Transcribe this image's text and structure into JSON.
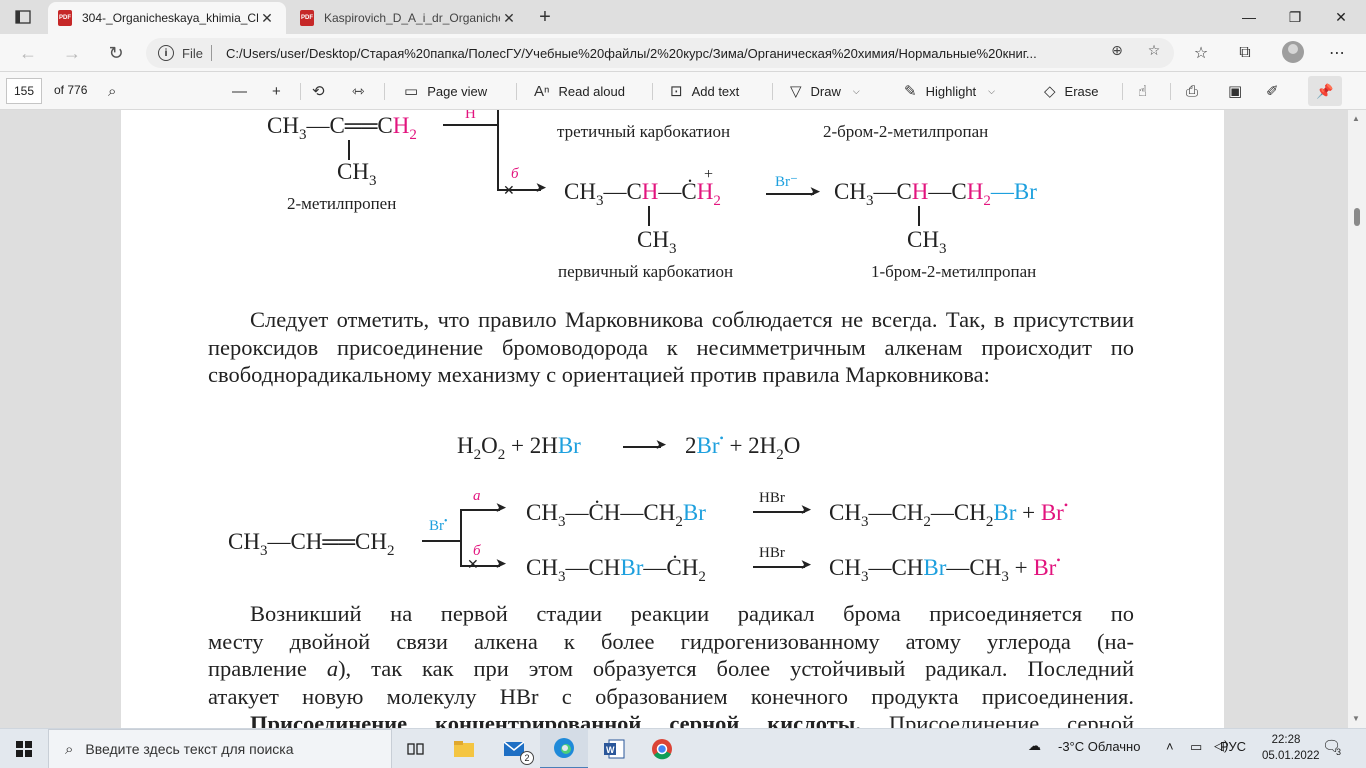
{
  "browser": {
    "tabs": [
      {
        "title": "304-_Organicheskaya_khimia_Ch",
        "active": true
      },
      {
        "title": "Kaspirovich_D_A_i_dr_Organiche",
        "active": false
      }
    ],
    "new_tab": "+",
    "file_label": "File",
    "url": "C:/Users/user/Desktop/Старая%20папка/ПолесГУ/Учебные%20файлы/2%20курс/Зима/Органическая%20химия/Нормальные%20книг..."
  },
  "pdf_toolbar": {
    "page_number": "155",
    "page_total": "of 776",
    "page_view": "Page view",
    "read_aloud": "Read aloud",
    "add_text": "Add text",
    "draw": "Draw",
    "highlight": "Highlight",
    "erase": "Erase"
  },
  "document": {
    "top_scheme": {
      "reactant_main": "CH",
      "reactant_methyl": "CH",
      "reactant_name": "2-метилпропен",
      "branch_label_b": "б",
      "branch_label_a_fragment": "H",
      "tert_cation_name": "третичный карбокатион",
      "tert_product_name": "2-бром-2-метилпропан",
      "primary_cation_name": "первичный карбокатион",
      "primary_product_name": "1-бром-2-метилпропан",
      "reagent": "Br"
    },
    "paragraph1": "Следует отметить, что правило Марковникова соблюдается не всегда. Так, в присутствии пероксидов присоединение бромоводорода к несимметричным алкенам происходит по свободнорадикальному механизму с ориентацией против правила Марковникова:",
    "radical_scheme": {
      "reagent_radical": "Br",
      "branch_a": "а",
      "branch_b": "б",
      "hbr": "HBr"
    },
    "paragraph2_line1": "Возникший на первой стадии реакции радикал брома присоединяется по",
    "paragraph2_line2": "месту двойной связи алкена к более гидрогенизованному атому углерода (на-",
    "paragraph2_line3_pre": "правление ",
    "paragraph2_line3_italic": "а",
    "paragraph2_line3_post": "), так как при этом образуется более устойчивый радикал. Последний",
    "paragraph2_line4": "атакует новую молекулу HBr с образованием конечного продукта присоединения.",
    "paragraph3_bold": "Присоединение концентрированной серной кислоты.",
    "paragraph3_rest": " Присоединение серной"
  },
  "taskbar": {
    "search_placeholder": "Введите здесь текст для поиска",
    "mail_badge": "2",
    "weather": "-3°C  Облачно",
    "language": "РУС",
    "time": "22:28",
    "date": "05.01.2022",
    "notifications": "3"
  },
  "colors": {
    "magenta": "#e2147e",
    "cyan": "#1ea0de"
  }
}
